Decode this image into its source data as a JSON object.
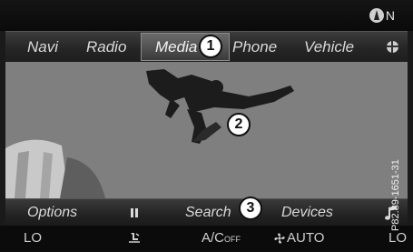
{
  "status": {
    "compass": "N"
  },
  "menu": {
    "items": [
      "Navi",
      "Radio",
      "Media",
      "Phone",
      "Vehicle"
    ],
    "active": "Media"
  },
  "callouts": [
    "1",
    "2",
    "3"
  ],
  "bottom_menu": {
    "options": "Options",
    "search": "Search",
    "devices": "Devices"
  },
  "climate": {
    "left_temp": "LO",
    "ac_label": "A/C",
    "ac_state": "OFF",
    "auto": "AUTO",
    "right_temp": "LO"
  },
  "figure_code": "P82.89-1651-31",
  "icons": [
    "compass-icon",
    "globe-icon",
    "pause-icon",
    "music-note-icon",
    "seat-airflow-icon",
    "fan-icon"
  ]
}
